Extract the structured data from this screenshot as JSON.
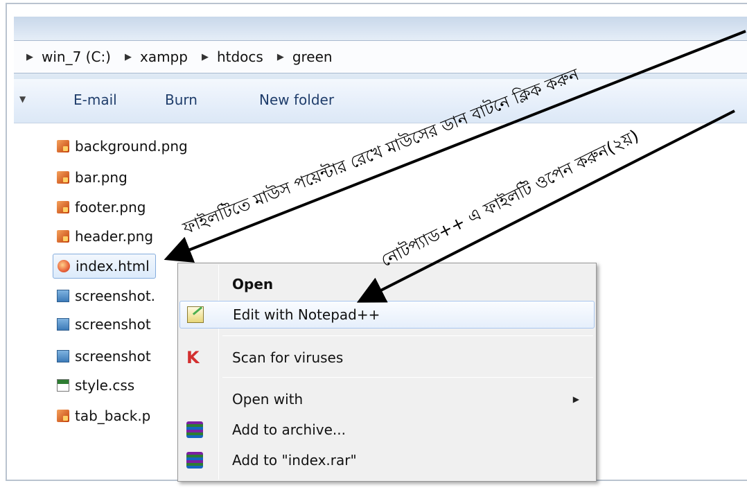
{
  "breadcrumb": {
    "items": [
      "win_7 (C:)",
      "xampp",
      "htdocs",
      "green"
    ]
  },
  "toolbar": {
    "items": [
      "E-mail",
      "Burn",
      "New folder"
    ]
  },
  "files": [
    {
      "name": "background.png",
      "icon": "image-file-icon"
    },
    {
      "name": "bar.png",
      "icon": "image-file-icon"
    },
    {
      "name": "footer.png",
      "icon": "image-file-icon"
    },
    {
      "name": "header.png",
      "icon": "image-file-icon"
    },
    {
      "name": "index.html",
      "icon": "html-file-icon",
      "selected": true
    },
    {
      "name": "screenshot.",
      "icon": "screenshot-file-icon"
    },
    {
      "name": "screenshot",
      "icon": "screenshot-file-icon"
    },
    {
      "name": "screenshot",
      "icon": "screenshot-file-icon"
    },
    {
      "name": "style.css",
      "icon": "css-file-icon"
    },
    {
      "name": "tab_back.p",
      "icon": "image-file-icon"
    }
  ],
  "context_menu": {
    "items": [
      {
        "label": "Open",
        "bold": true
      },
      {
        "label": "Edit with Notepad++",
        "icon": "notepadpp-icon",
        "highlighted": true
      },
      {
        "label": "Scan for viruses",
        "icon": "kaspersky-icon"
      },
      {
        "label": "Open with",
        "submenu": true
      },
      {
        "label": "Add to archive...",
        "icon": "winrar-icon"
      },
      {
        "label": "Add to \"index.rar\"",
        "icon": "winrar-icon"
      }
    ]
  },
  "annotations": {
    "step1": "ফাইলটিতে  মাউস পয়েন্টার রেখে মাউসের ডান বাটনে ক্লিক করুন",
    "step2": "নোটপ্যাড++ এ ফাইলটি ওপেন করুন(২য়)"
  }
}
